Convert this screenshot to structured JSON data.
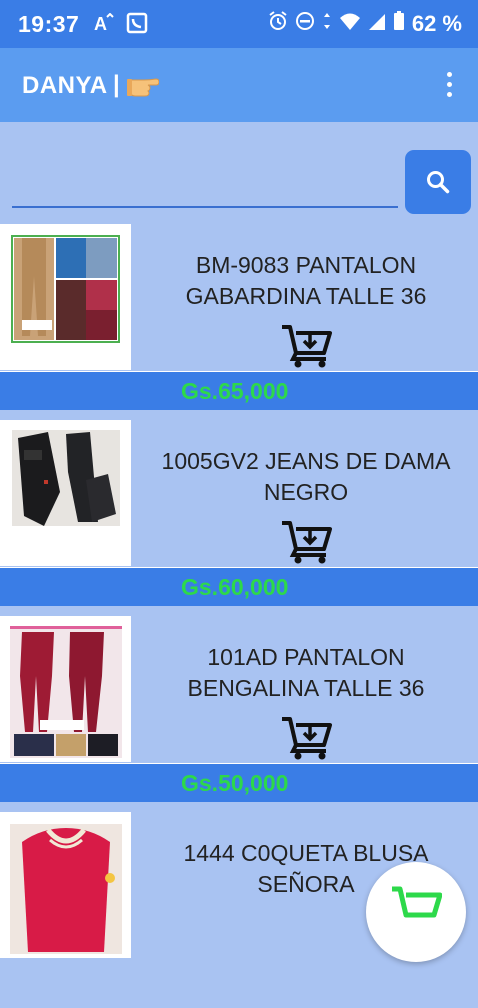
{
  "status_bar": {
    "time": "19:37",
    "battery_percent": "62 %"
  },
  "app_bar": {
    "title": "DANYA",
    "separator": "|"
  },
  "search": {
    "placeholder": "",
    "value": ""
  },
  "products": [
    {
      "title": "BM-9083 PANTALON GABARDINA TALLE 36",
      "price": "Gs.65,000"
    },
    {
      "title": "1005GV2 JEANS DE DAMA NEGRO",
      "price": "Gs.60,000"
    },
    {
      "title": "101AD PANTALON BENGALINA TALLE 36",
      "price": "Gs.50,000"
    },
    {
      "title": "1444 C0QUETA BLUSA SEÑORA",
      "price": ""
    }
  ],
  "colors": {
    "status_bar": "#3a7de6",
    "app_bar": "#5b9cf0",
    "background": "#a9c3f2",
    "price_bar": "#3a7de6",
    "price_text": "#2dd94a"
  }
}
